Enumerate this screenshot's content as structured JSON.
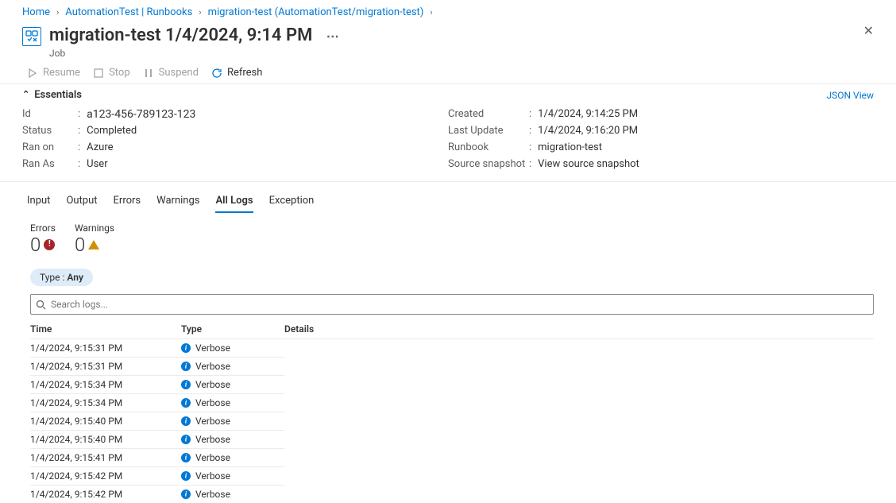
{
  "breadcrumb": {
    "home": "Home",
    "runbooks": "AutomationTest | Runbooks",
    "runbook": "migration-test (AutomationTest/migration-test)"
  },
  "header": {
    "title": "migration-test 1/4/2024, 9:14 PM",
    "subtitle": "Job"
  },
  "toolbar": {
    "resume": "Resume",
    "stop": "Stop",
    "suspend": "Suspend",
    "refresh": "Refresh"
  },
  "essentials": {
    "label": "Essentials",
    "jsonView": "JSON View",
    "left": {
      "id_label": "Id",
      "id": "a123-456-789123-123",
      "status_label": "Status",
      "status": "Completed",
      "ranon_label": "Ran on",
      "ranon": "Azure",
      "ranas_label": "Ran As",
      "ranas": "User"
    },
    "right": {
      "created_label": "Created",
      "created": "1/4/2024, 9:14:25 PM",
      "lastupdate_label": "Last Update",
      "lastupdate": "1/4/2024, 9:16:20 PM",
      "runbook_label": "Runbook",
      "runbook": "migration-test",
      "snapshot_label": "Source snapshot",
      "snapshot": "View source snapshot"
    }
  },
  "tabs": {
    "input": "Input",
    "output": "Output",
    "errors": "Errors",
    "warnings": "Warnings",
    "alllogs": "All Logs",
    "exception": "Exception"
  },
  "counters": {
    "errors_label": "Errors",
    "errors_value": "0",
    "warnings_label": "Warnings",
    "warnings_value": "0"
  },
  "filter": {
    "type_label": "Type : ",
    "type_value": "Any"
  },
  "search": {
    "placeholder": "Search logs..."
  },
  "logtable": {
    "col_time": "Time",
    "col_type": "Type",
    "col_details": "Details",
    "rows": [
      {
        "time": "1/4/2024, 9:15:31 PM",
        "type": "Verbose"
      },
      {
        "time": "1/4/2024, 9:15:31 PM",
        "type": "Verbose"
      },
      {
        "time": "1/4/2024, 9:15:34 PM",
        "type": "Verbose"
      },
      {
        "time": "1/4/2024, 9:15:34 PM",
        "type": "Verbose"
      },
      {
        "time": "1/4/2024, 9:15:40 PM",
        "type": "Verbose"
      },
      {
        "time": "1/4/2024, 9:15:40 PM",
        "type": "Verbose"
      },
      {
        "time": "1/4/2024, 9:15:41 PM",
        "type": "Verbose"
      },
      {
        "time": "1/4/2024, 9:15:42 PM",
        "type": "Verbose"
      },
      {
        "time": "1/4/2024, 9:15:42 PM",
        "type": "Verbose"
      }
    ]
  }
}
